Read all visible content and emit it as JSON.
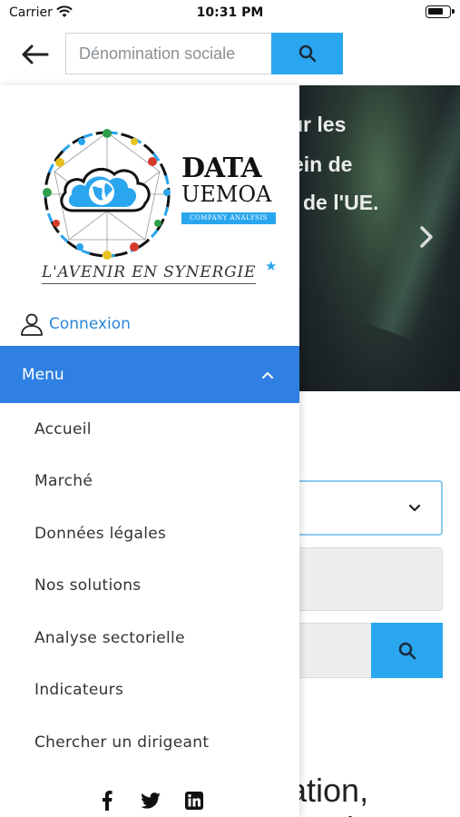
{
  "status_bar": {
    "carrier": "Carrier",
    "time": "10:31 PM"
  },
  "header": {
    "search_placeholder": "Dénomination sociale",
    "back_icon": "arrow-left-icon",
    "search_icon": "search-icon"
  },
  "hero": {
    "lines": [
      "ur les",
      "ein de",
      "de l'UE."
    ],
    "next_icon": "chevron-right-icon"
  },
  "background": {
    "heading_line1": "cation,",
    "heading_line2": "ri"
  },
  "drawer": {
    "logo": {
      "data_word": "DATA",
      "uemoa_word": "UEMOA",
      "badge": "COMPANY ANALYSIS"
    },
    "tagline": "L'AVENIR EN SYNERGIE",
    "login_label": "Connexion",
    "menu_label": "Menu",
    "menu_items": [
      "Accueil",
      "Marché",
      "Données légales",
      "Nos solutions",
      "Analyse sectorielle",
      "Indicateurs",
      "Chercher un dirigeant"
    ],
    "socials": [
      "facebook-icon",
      "twitter-icon",
      "linkedin-icon"
    ]
  },
  "colors": {
    "accent_blue": "#2aa6ee",
    "menu_blue": "#2f80e2",
    "link_blue": "#2a86d8"
  }
}
